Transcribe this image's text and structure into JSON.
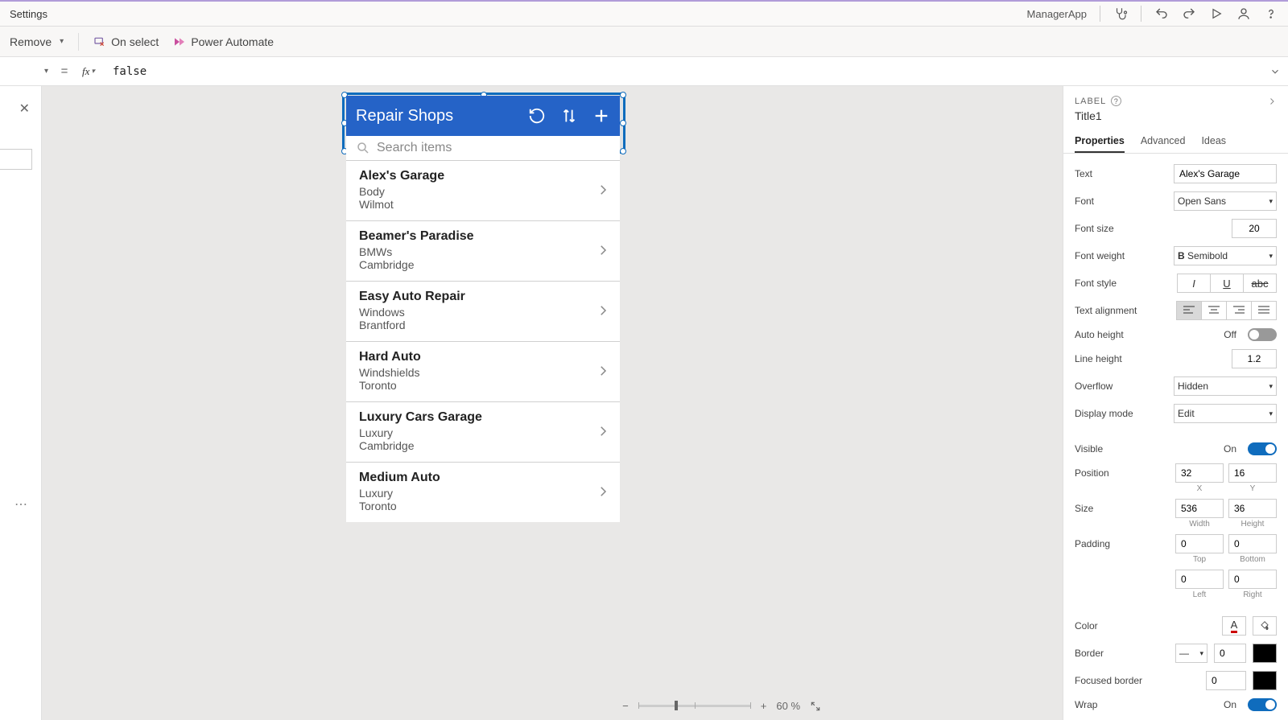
{
  "titlebar": {
    "settings": "Settings",
    "appname": "ManagerApp"
  },
  "ribbon": {
    "remove": "Remove",
    "onselect": "On select",
    "power_automate": "Power Automate"
  },
  "formula": {
    "value": "false"
  },
  "phone": {
    "title": "Repair Shops",
    "search_placeholder": "Search items",
    "items": [
      {
        "title": "Alex's Garage",
        "sub1": "Body",
        "sub2": "Wilmot"
      },
      {
        "title": "Beamer's Paradise",
        "sub1": "BMWs",
        "sub2": "Cambridge"
      },
      {
        "title": "Easy Auto Repair",
        "sub1": "Windows",
        "sub2": "Brantford"
      },
      {
        "title": "Hard Auto",
        "sub1": "Windshields",
        "sub2": "Toronto"
      },
      {
        "title": "Luxury Cars Garage",
        "sub1": "Luxury",
        "sub2": "Cambridge"
      },
      {
        "title": "Medium Auto",
        "sub1": "Luxury",
        "sub2": "Toronto"
      }
    ]
  },
  "props": {
    "head": "LABEL",
    "name": "Title1",
    "tabs": {
      "properties": "Properties",
      "advanced": "Advanced",
      "ideas": "Ideas"
    },
    "text_lbl": "Text",
    "text_val": "Alex's Garage",
    "font_lbl": "Font",
    "font_val": "Open Sans",
    "fontsize_lbl": "Font size",
    "fontsize_val": "20",
    "fontweight_lbl": "Font weight",
    "fontweight_val": "Semibold",
    "fontstyle_lbl": "Font style",
    "textalign_lbl": "Text alignment",
    "autoheight_lbl": "Auto height",
    "autoheight_val": "Off",
    "lineheight_lbl": "Line height",
    "lineheight_val": "1.2",
    "overflow_lbl": "Overflow",
    "overflow_val": "Hidden",
    "displaymode_lbl": "Display mode",
    "displaymode_val": "Edit",
    "visible_lbl": "Visible",
    "visible_val": "On",
    "position_lbl": "Position",
    "pos_x": "32",
    "pos_y": "16",
    "pos_xl": "X",
    "pos_yl": "Y",
    "size_lbl": "Size",
    "size_w": "536",
    "size_h": "36",
    "size_wl": "Width",
    "size_hl": "Height",
    "padding_lbl": "Padding",
    "pad_t": "0",
    "pad_b": "0",
    "pad_l": "0",
    "pad_r": "0",
    "pad_tl": "Top",
    "pad_bl": "Bottom",
    "pad_ll": "Left",
    "pad_rl": "Right",
    "color_lbl": "Color",
    "border_lbl": "Border",
    "border_val": "0",
    "focusborder_lbl": "Focused border",
    "focusborder_val": "0",
    "wrap_lbl": "Wrap",
    "wrap_val": "On"
  },
  "zoom": {
    "pct": "60",
    "unit": "%"
  }
}
